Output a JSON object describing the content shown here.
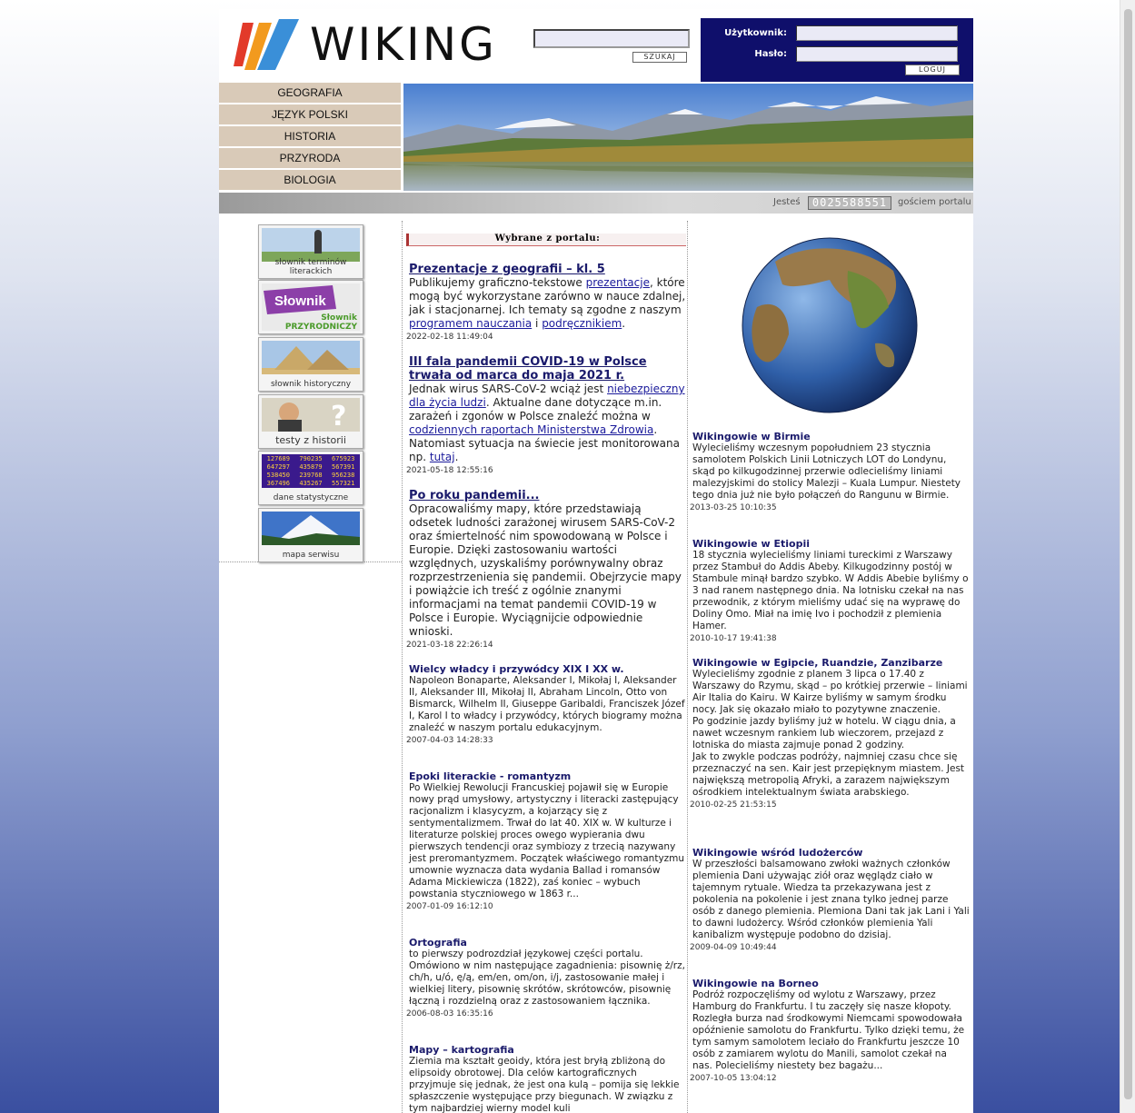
{
  "header": {
    "logo_text": "WIKING",
    "search_button": "SZUKAJ",
    "login_user_label": "Użytkownik:",
    "login_pass_label": "Hasło:",
    "login_button": "LOGUJ"
  },
  "nav": [
    "GEOGRAFIA",
    "JĘZYK POLSKI",
    "HISTORIA",
    "PRZYRODA",
    "BIOLOGIA"
  ],
  "status": {
    "prefix": "Jesteś",
    "counter": "0025588551",
    "suffix": "gościem portalu"
  },
  "sidebar": [
    {
      "caption": "słownik terminów literackich"
    },
    {
      "caption": "Słownik PRZYRODNICZY"
    },
    {
      "caption": "słownik historyczny"
    },
    {
      "caption": "testy z historii"
    },
    {
      "caption": "dane statystyczne"
    },
    {
      "caption": "mapa serwisu"
    }
  ],
  "stats_table": [
    "127689",
    "790235",
    "675923",
    "647297",
    "435879",
    "567391",
    "538450",
    "239768",
    "956238",
    "367496",
    "435267",
    "557321"
  ],
  "center": {
    "heading": "Wybrane z portalu:",
    "articles": [
      {
        "title": "Prezentacje z geografii – kl. 5",
        "date": "2022-02-18 11:49:04",
        "p1": "Publikujemy graficzno-tekstowe ",
        "l1": "prezentacje",
        "p2": ", które mogą być wykorzystane zarówno w nauce zdalnej, jak i stacjonarnej. Ich tematy są zgodne z naszym ",
        "l2": "programem nauczania",
        "p3": " i ",
        "l3": "podręcznikiem",
        "p4": "."
      },
      {
        "title": "III fala pandemii COVID-19 w Polsce trwała od marca do maja 2021 r.",
        "date": "2021-05-18 12:55:16",
        "p1": "Jednak wirus SARS-CoV-2 wciąż jest ",
        "l1": "niebezpieczny dla życia ludzi",
        "p2": ". Aktualne dane dotyczące m.in. zarażeń i zgonów w Polsce znaleźć można w ",
        "l2": "codziennych raportach Ministerstwa Zdrowia",
        "p3": ". Natomiast sytuacja na świecie jest monitorowana np. ",
        "l3": "tutaj",
        "p4": "."
      },
      {
        "title": "Po roku pandemii...",
        "date": "2021-03-18 22:26:14",
        "body": "Opracowaliśmy mapy, które przedstawiają odsetek ludności zarażonej wirusem SARS-CoV-2 oraz śmiertelność nim spowodowaną w Polsce i Europie. Dzięki zastosowaniu wartości względnych, uzyskaliśmy porównywalny obraz rozprzestrzenienia się pandemii. Obejrzycie mapy i powiążcie ich treść z ogólnie znanymi informacjami na temat pandemii COVID-19 w Polsce i Europie. Wyciągnijcie odpowiednie wnioski."
      },
      {
        "title": "Wielcy władcy i przywódcy XIX I XX w.",
        "date": "2007-04-03 14:28:33",
        "body": "Napoleon Bonaparte, Aleksander I, Mikołaj I, Aleksander II, Aleksander III, Mikołaj II, Abraham Lincoln, Otto von Bismarck, Wilhelm II, Giuseppe Garibaldi, Franciszek Józef I, Karol I to władcy i przywódcy, których biogramy można znaleźć w naszym portalu edukacyjnym."
      },
      {
        "title": "Epoki literackie - romantyzm",
        "date": "2007-01-09 16:12:10",
        "body": "Po Wielkiej Rewolucji Francuskiej pojawił się w Europie nowy prąd umysłowy, artystyczny i literacki zastępujący racjonalizm i klasycyzm, a kojarzący się z sentymentalizmem. Trwał do lat 40. XIX w. W kulturze i literaturze polskiej proces owego wypierania dwu pierwszych tendencji oraz symbiozy z trzecią nazywany jest preromantyzmem. Początek właściwego romantyzmu umownie wyznacza data wydania Ballad i romansów Adama Mickiewicza (1822), zaś koniec – wybuch powstania styczniowego w 1863 r..."
      },
      {
        "title": "Ortografia",
        "date": "2006-08-03 16:35:16",
        "body": "to pierwszy podrozdział językowej części portalu. Omówiono w nim następujące zagadnienia: pisownię ż/rz, ch/h, u/ó, ę/ą, em/en, om/on, i/j, zastosowanie małej i wielkiej litery, pisownię skrótów, skrótowców, pisownię łączną i rozdzielną oraz z zastosowaniem łącznika."
      },
      {
        "title": "Mapy – kartografia",
        "date": "",
        "body": "Ziemia ma kształt geoidy, która jest bryłą zbliżoną do elipsoidy obrotowej. Dla celów kartograficznych przyjmuje się jednak, że jest ona kulą – pomija się lekkie spłaszczenie występujące przy biegunach. W związku z tym najbardziej wierny model kuli"
      }
    ]
  },
  "right": {
    "articles": [
      {
        "title": "Wikingowie w Birmie",
        "date": "2013-03-25 10:10:35",
        "body": "Wylecieliśmy wczesnym popołudniem 23 stycznia samolotem Polskich Linii Lotniczych LOT do Londynu, skąd po kilkugodzinnej przerwie odlecieliśmy liniami malezyjskimi do stolicy Malezji – Kuala Lumpur. Niestety tego dnia już nie było połączeń do Rangunu w Birmie."
      },
      {
        "title": "Wikingowie w Etiopii",
        "date": "2010-10-17 19:41:38",
        "body": "18 stycznia wylecieliśmy liniami tureckimi z Warszawy przez Stambuł do Addis Abeby. Kilkugodzinny postój w Stambule minął bardzo szybko. W Addis Abebie byliśmy o 3 nad ranem następnego dnia. Na lotnisku czekał na nas przewodnik, z którym mieliśmy udać się na wyprawę do Doliny Omo. Miał na imię Ivo i pochodził z plemienia Hamer."
      },
      {
        "title": "Wikingowie w Egipcie, Ruandzie, Zanzibarze",
        "date": "2010-02-25 21:53:15",
        "body": "Wylecieliśmy zgodnie z planem 3 lipca o 17.40 z Warszawy do Rzymu, skąd – po krótkiej przerwie – liniami Air Italia do Kairu. W Kairze byliśmy w samym środku nocy. Jak się okazało miało to pozytywne znaczenie.\nPo godzinie jazdy byliśmy już w hotelu. W ciągu dnia, a nawet wczesnym rankiem lub wieczorem, przejazd z lotniska do miasta zajmuje ponad 2 godziny.\nJak to zwykle podczas podróży, najmniej czasu chce się przeznaczyć na sen. Kair jest przepięknym miastem. Jest największą metropolią Afryki, a zarazem największym ośrodkiem intelektualnym świata arabskiego."
      },
      {
        "title": "Wikingowie wśród ludożerców",
        "date": "2009-04-09 10:49:44",
        "body": "W przeszłości balsamowano zwłoki ważnych członków plemienia Dani używając ziół oraz węglądz ciało w tajemnym rytuale. Wiedza ta przekazywana jest z pokolenia na pokolenie i jest znana tylko jednej parze osób z danego plemienia. Plemiona Dani tak jak Lani i Yali to dawni ludożercy. Wśród członków plemienia Yali kanibalizm występuje podobno do dzisiaj."
      },
      {
        "title": "Wikingowie na Borneo",
        "date": "2007-10-05 13:04:12",
        "body": "Podróż rozpoczęliśmy od wylotu z Warszawy, przez Hamburg do Frankfurtu. I tu zaczęły się nasze kłopoty. Rozległa burza nad środkowymi Niemcami spowodowała opóźnienie samolotu do Frankfurtu. Tylko dzięki temu, że tym samym samolotem leciało do Frankfurtu jeszcze 10 osób z zamiarem wylotu do Manili, samolot czekał na nas. Polecieliśmy niestety bez bagażu..."
      }
    ]
  }
}
